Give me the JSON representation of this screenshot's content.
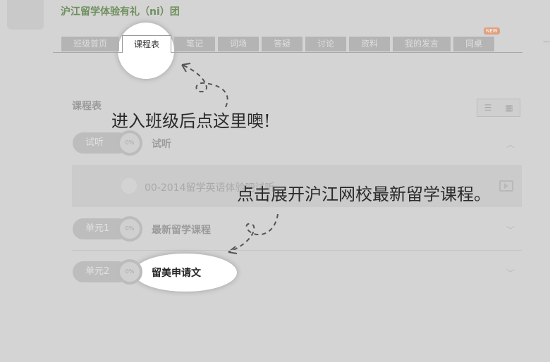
{
  "header": {
    "class_title": "沪江留学体验有礼（ni）团"
  },
  "tabs": [
    {
      "label": "班级首页"
    },
    {
      "label": "课程表"
    },
    {
      "label": "笔记"
    },
    {
      "label": "词场"
    },
    {
      "label": "答疑"
    },
    {
      "label": "讨论"
    },
    {
      "label": "资料"
    },
    {
      "label": "我的发言"
    },
    {
      "label": "同桌"
    }
  ],
  "new_badge": "NEW",
  "schedule": {
    "title": "课程表",
    "view_toggle": {
      "list_icon": "list-view-icon",
      "grid_icon": "grid-view-icon"
    },
    "units": [
      {
        "badge": "试听",
        "progress": "0%",
        "name": "试听",
        "expanded": true
      },
      {
        "badge": "单元1",
        "progress": "0%",
        "name": "最新留学课程",
        "expanded": false
      },
      {
        "badge": "单元2",
        "progress": "0%",
        "name": "留美申请文",
        "expanded": false
      }
    ],
    "lesson": {
      "title": "00-2014留学英语体验吧试听"
    }
  },
  "annotations": {
    "hint_tab": "进入班级后点这里噢!",
    "hint_unit": "点击展开沪江网校最新留学课程。"
  },
  "colors": {
    "class_title": "#6f8f5d",
    "overlay": "#d4d4d4",
    "spotlight": "#ffffff"
  }
}
